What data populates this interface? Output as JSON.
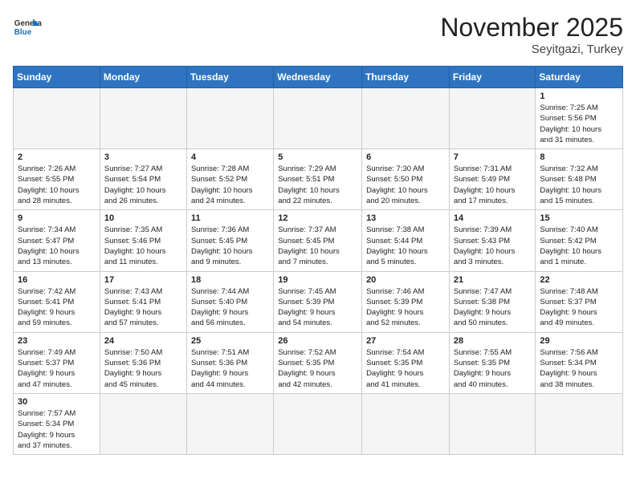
{
  "header": {
    "logo_general": "General",
    "logo_blue": "Blue",
    "month_year": "November 2025",
    "location": "Seyitgazi, Turkey"
  },
  "days_of_week": [
    "Sunday",
    "Monday",
    "Tuesday",
    "Wednesday",
    "Thursday",
    "Friday",
    "Saturday"
  ],
  "weeks": [
    [
      {
        "day": "",
        "info": "",
        "empty": true
      },
      {
        "day": "",
        "info": "",
        "empty": true
      },
      {
        "day": "",
        "info": "",
        "empty": true
      },
      {
        "day": "",
        "info": "",
        "empty": true
      },
      {
        "day": "",
        "info": "",
        "empty": true
      },
      {
        "day": "",
        "info": "",
        "empty": true
      },
      {
        "day": "1",
        "info": "Sunrise: 7:25 AM\nSunset: 5:56 PM\nDaylight: 10 hours\nand 31 minutes."
      }
    ],
    [
      {
        "day": "2",
        "info": "Sunrise: 7:26 AM\nSunset: 5:55 PM\nDaylight: 10 hours\nand 28 minutes."
      },
      {
        "day": "3",
        "info": "Sunrise: 7:27 AM\nSunset: 5:54 PM\nDaylight: 10 hours\nand 26 minutes."
      },
      {
        "day": "4",
        "info": "Sunrise: 7:28 AM\nSunset: 5:52 PM\nDaylight: 10 hours\nand 24 minutes."
      },
      {
        "day": "5",
        "info": "Sunrise: 7:29 AM\nSunset: 5:51 PM\nDaylight: 10 hours\nand 22 minutes."
      },
      {
        "day": "6",
        "info": "Sunrise: 7:30 AM\nSunset: 5:50 PM\nDaylight: 10 hours\nand 20 minutes."
      },
      {
        "day": "7",
        "info": "Sunrise: 7:31 AM\nSunset: 5:49 PM\nDaylight: 10 hours\nand 17 minutes."
      },
      {
        "day": "8",
        "info": "Sunrise: 7:32 AM\nSunset: 5:48 PM\nDaylight: 10 hours\nand 15 minutes."
      }
    ],
    [
      {
        "day": "9",
        "info": "Sunrise: 7:34 AM\nSunset: 5:47 PM\nDaylight: 10 hours\nand 13 minutes."
      },
      {
        "day": "10",
        "info": "Sunrise: 7:35 AM\nSunset: 5:46 PM\nDaylight: 10 hours\nand 11 minutes."
      },
      {
        "day": "11",
        "info": "Sunrise: 7:36 AM\nSunset: 5:45 PM\nDaylight: 10 hours\nand 9 minutes."
      },
      {
        "day": "12",
        "info": "Sunrise: 7:37 AM\nSunset: 5:45 PM\nDaylight: 10 hours\nand 7 minutes."
      },
      {
        "day": "13",
        "info": "Sunrise: 7:38 AM\nSunset: 5:44 PM\nDaylight: 10 hours\nand 5 minutes."
      },
      {
        "day": "14",
        "info": "Sunrise: 7:39 AM\nSunset: 5:43 PM\nDaylight: 10 hours\nand 3 minutes."
      },
      {
        "day": "15",
        "info": "Sunrise: 7:40 AM\nSunset: 5:42 PM\nDaylight: 10 hours\nand 1 minute."
      }
    ],
    [
      {
        "day": "16",
        "info": "Sunrise: 7:42 AM\nSunset: 5:41 PM\nDaylight: 9 hours\nand 59 minutes."
      },
      {
        "day": "17",
        "info": "Sunrise: 7:43 AM\nSunset: 5:41 PM\nDaylight: 9 hours\nand 57 minutes."
      },
      {
        "day": "18",
        "info": "Sunrise: 7:44 AM\nSunset: 5:40 PM\nDaylight: 9 hours\nand 56 minutes."
      },
      {
        "day": "19",
        "info": "Sunrise: 7:45 AM\nSunset: 5:39 PM\nDaylight: 9 hours\nand 54 minutes."
      },
      {
        "day": "20",
        "info": "Sunrise: 7:46 AM\nSunset: 5:39 PM\nDaylight: 9 hours\nand 52 minutes."
      },
      {
        "day": "21",
        "info": "Sunrise: 7:47 AM\nSunset: 5:38 PM\nDaylight: 9 hours\nand 50 minutes."
      },
      {
        "day": "22",
        "info": "Sunrise: 7:48 AM\nSunset: 5:37 PM\nDaylight: 9 hours\nand 49 minutes."
      }
    ],
    [
      {
        "day": "23",
        "info": "Sunrise: 7:49 AM\nSunset: 5:37 PM\nDaylight: 9 hours\nand 47 minutes."
      },
      {
        "day": "24",
        "info": "Sunrise: 7:50 AM\nSunset: 5:36 PM\nDaylight: 9 hours\nand 45 minutes."
      },
      {
        "day": "25",
        "info": "Sunrise: 7:51 AM\nSunset: 5:36 PM\nDaylight: 9 hours\nand 44 minutes."
      },
      {
        "day": "26",
        "info": "Sunrise: 7:52 AM\nSunset: 5:35 PM\nDaylight: 9 hours\nand 42 minutes."
      },
      {
        "day": "27",
        "info": "Sunrise: 7:54 AM\nSunset: 5:35 PM\nDaylight: 9 hours\nand 41 minutes."
      },
      {
        "day": "28",
        "info": "Sunrise: 7:55 AM\nSunset: 5:35 PM\nDaylight: 9 hours\nand 40 minutes."
      },
      {
        "day": "29",
        "info": "Sunrise: 7:56 AM\nSunset: 5:34 PM\nDaylight: 9 hours\nand 38 minutes."
      }
    ],
    [
      {
        "day": "30",
        "info": "Sunrise: 7:57 AM\nSunset: 5:34 PM\nDaylight: 9 hours\nand 37 minutes."
      },
      {
        "day": "",
        "info": "",
        "empty": true
      },
      {
        "day": "",
        "info": "",
        "empty": true
      },
      {
        "day": "",
        "info": "",
        "empty": true
      },
      {
        "day": "",
        "info": "",
        "empty": true
      },
      {
        "day": "",
        "info": "",
        "empty": true
      },
      {
        "day": "",
        "info": "",
        "empty": true
      }
    ]
  ]
}
